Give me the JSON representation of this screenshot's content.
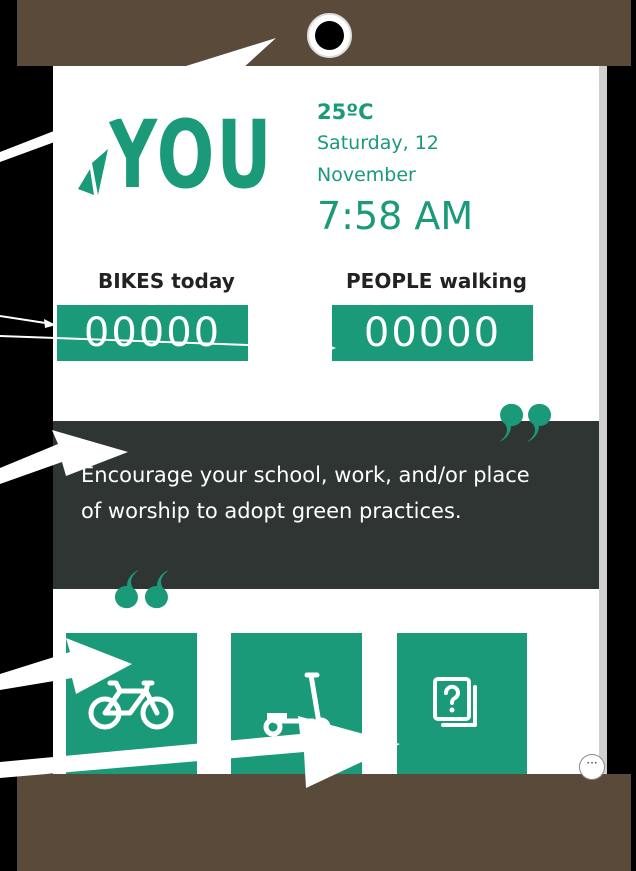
{
  "header": {
    "logo_text": "YOU",
    "temperature": "25ºC",
    "date_line1": "Saturday, 12",
    "date_line2": "November",
    "time": "7:58 AM"
  },
  "counters": {
    "bikes_label": "BIKES today",
    "bikes_value": "00000",
    "people_label": "PEOPLE walking",
    "people_value": "00000"
  },
  "quote": {
    "text": "Encourage your school, work, and/or place of worship to adopt green practices."
  },
  "tiles": [
    {
      "icon": "bicycle-icon"
    },
    {
      "icon": "scooter-icon"
    },
    {
      "icon": "quiz-icon"
    }
  ],
  "more_button": {
    "label": "···"
  },
  "colors": {
    "accent": "#1a9a78",
    "frame": "#5a4a3a",
    "quote_panel": "#2e3532",
    "background": "#000000"
  }
}
